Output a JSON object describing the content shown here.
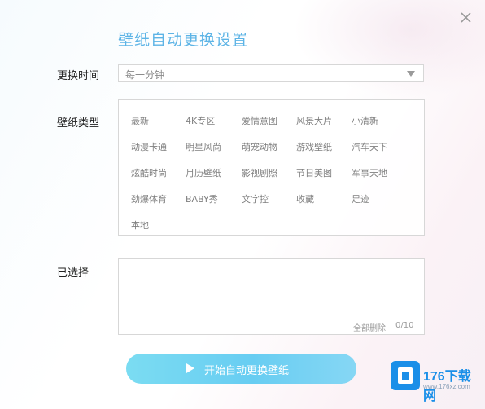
{
  "dialog": {
    "title": "壁纸自动更换设置",
    "close_icon": "close-icon"
  },
  "interval": {
    "label": "更换时间",
    "value": "每一分钟"
  },
  "types": {
    "label": "壁纸类型",
    "items": [
      "最新",
      "4K专区",
      "爱情意图",
      "风景大片",
      "小清新",
      "动漫卡通",
      "明星风尚",
      "萌宠动物",
      "游戏壁纸",
      "汽车天下",
      "炫酷时尚",
      "月历壁纸",
      "影视剧照",
      "节日美图",
      "军事天地",
      "劲爆体育",
      "BABY秀",
      "文字控",
      "收藏",
      "足迹",
      "本地"
    ]
  },
  "selected": {
    "label": "已选择",
    "clear_label": "全部删除",
    "count": "0/10"
  },
  "start_button": {
    "label": "开始自动更换壁纸"
  },
  "logo": {
    "text": "176下载网",
    "sub": "www.176xz.com",
    "brand_color": "#1a8fe8"
  },
  "colors": {
    "title": "#5db4e6",
    "button": "#68cdf2"
  }
}
